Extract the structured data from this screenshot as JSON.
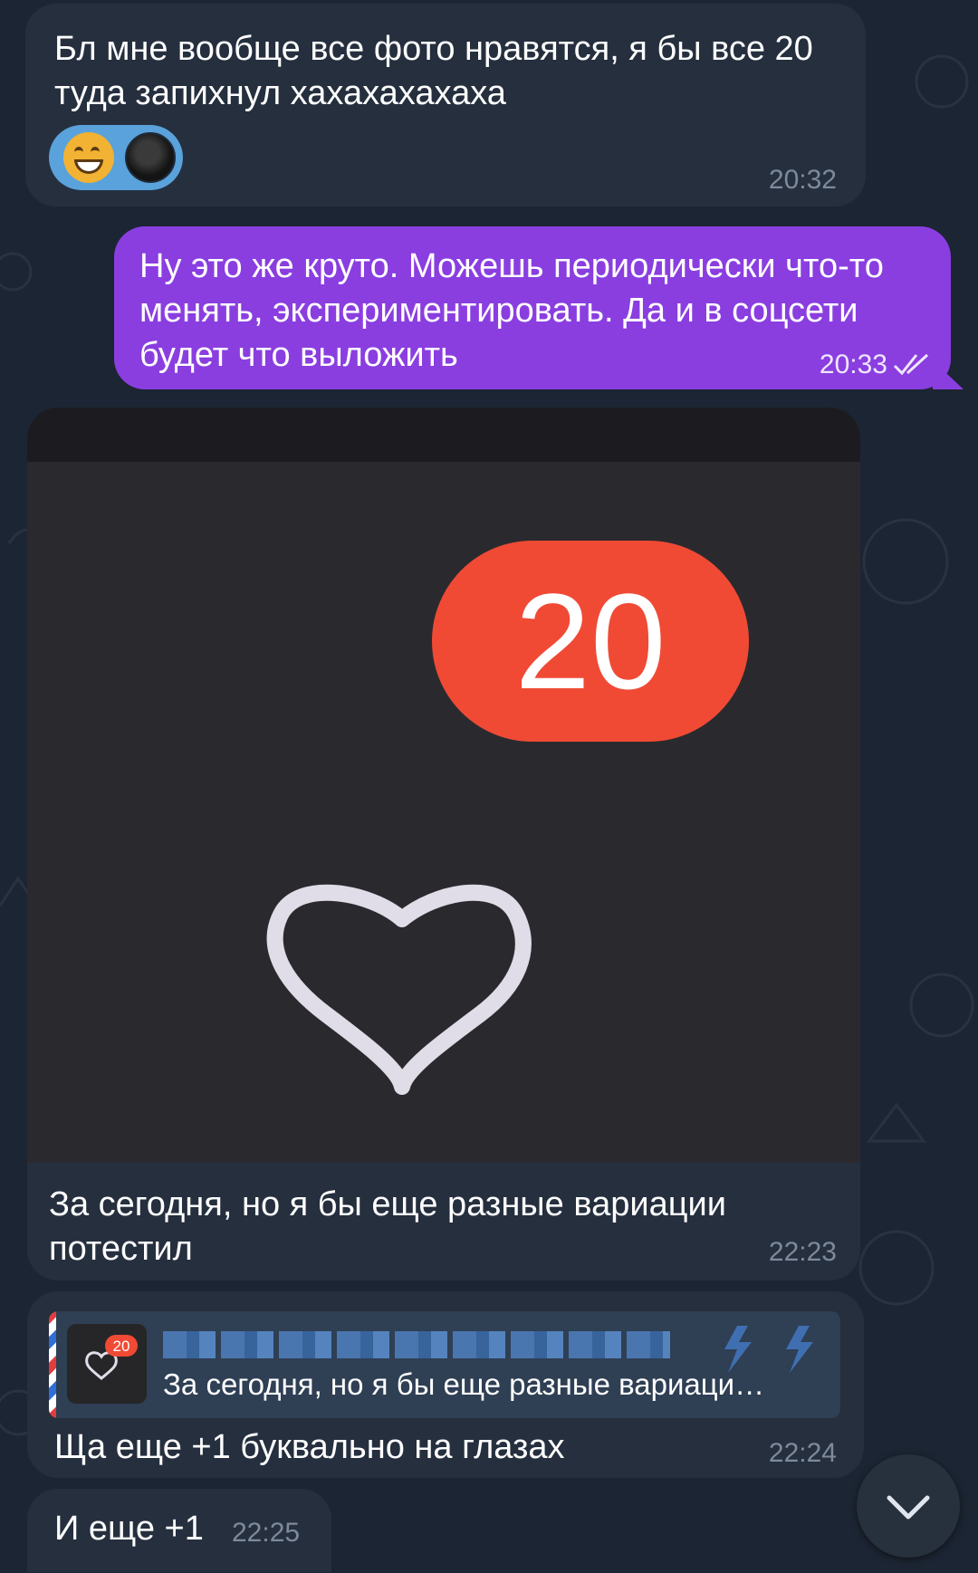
{
  "messages": [
    {
      "direction": "incoming",
      "text": "Бл мне вообще все фото нравятся, я бы все 20 туда запихнул хахахахахаха",
      "time": "20:32",
      "reactions": [
        "grinning-face-emoji",
        "user-avatar"
      ]
    },
    {
      "direction": "outgoing",
      "text": "Ну это же круто. Можешь периодически что-то менять, экспериментировать. Да и в соцсети будет что выложить",
      "time": "20:33",
      "status": "read"
    },
    {
      "direction": "incoming",
      "photo": {
        "badge_count": "20",
        "icon": "heart-outline-icon"
      },
      "text": "За сегодня, но я бы еще разные вариации потестил",
      "time": "22:23"
    },
    {
      "direction": "incoming",
      "reply": {
        "thumb_badge": "20",
        "text": "За сегодня, но я бы еще разные вариаци…"
      },
      "text": "Ща еще +1 буквально на глазах",
      "time": "22:24"
    },
    {
      "direction": "incoming",
      "text": "И еще +1",
      "time": "22:25"
    }
  ],
  "colors": {
    "background": "#1c2533",
    "incoming_bubble": "#252f3e",
    "outgoing_bubble": "#8a3ee0",
    "badge": "#f04a35",
    "time": "#7d8a9c"
  },
  "fab_icon": "chevron-down-icon"
}
